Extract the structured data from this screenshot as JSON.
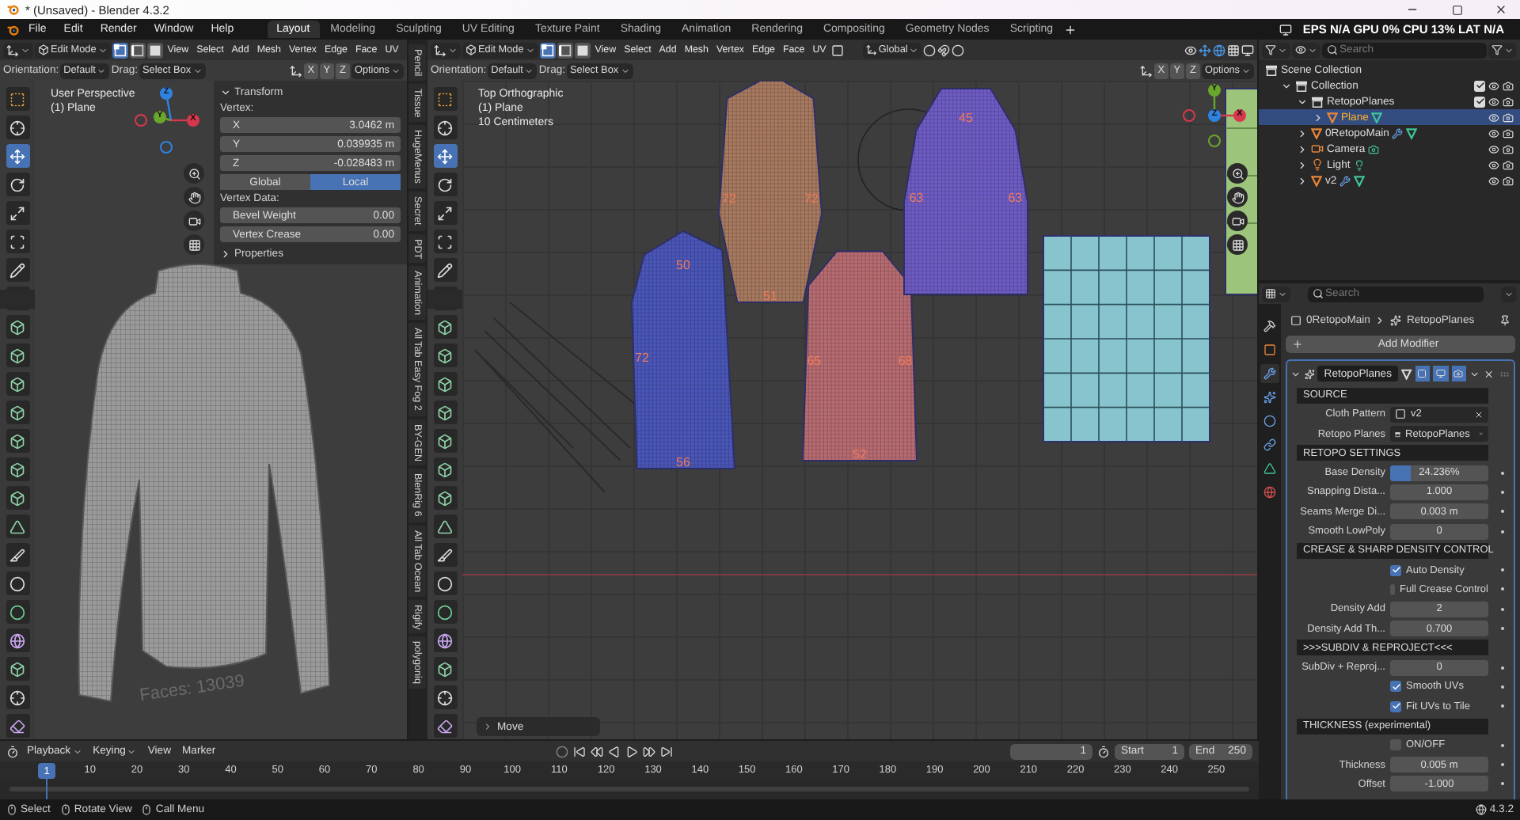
{
  "window": {
    "title": "* (Unsaved) - Blender 4.3.2"
  },
  "menu": [
    "File",
    "Edit",
    "Render",
    "Window",
    "Help"
  ],
  "workspaces": [
    {
      "label": "Layout",
      "selected": true
    },
    {
      "label": "Modeling",
      "selected": false
    },
    {
      "label": "Sculpting",
      "selected": false
    },
    {
      "label": "UV Editing",
      "selected": false
    },
    {
      "label": "Texture Paint",
      "selected": false
    },
    {
      "label": "Shading",
      "selected": false
    },
    {
      "label": "Animation",
      "selected": false
    },
    {
      "label": "Rendering",
      "selected": false
    },
    {
      "label": "Compositing",
      "selected": false
    },
    {
      "label": "Geometry Nodes",
      "selected": false
    },
    {
      "label": "Scripting",
      "selected": false
    }
  ],
  "stats": "EPS N/A GPU 0% CPU 13% LAT N/A",
  "left_viewport": {
    "mode": "Edit Mode",
    "select_modes": [
      {
        "kind": "vertex",
        "selected": true
      },
      {
        "kind": "edge",
        "selected": false
      },
      {
        "kind": "face",
        "selected": false
      }
    ],
    "menus": [
      "View",
      "Select",
      "Add",
      "Mesh",
      "Vertex",
      "Edge",
      "Face",
      "UV"
    ],
    "orientation_label": "Orientation:",
    "orientation": "Default",
    "drag_label": "Drag:",
    "drag": "Select Box",
    "axes": [
      "X",
      "Y",
      "Z"
    ],
    "options": "Options",
    "overlay": [
      "User Perspective",
      "(1) Plane"
    ],
    "gizmo": [
      "Z",
      "Y",
      "X"
    ],
    "faces": "Faces: 13039",
    "tools": [
      {
        "kind": "select",
        "selected": false
      },
      {
        "kind": "cursor",
        "selected": false
      },
      {
        "kind": "move",
        "selected": true
      },
      {
        "kind": "rotate",
        "selected": false
      },
      {
        "kind": "scale",
        "selected": false
      },
      {
        "kind": "transform",
        "selected": false
      },
      {
        "kind": "annotate",
        "selected": false
      },
      {
        "kind": "measure",
        "selected": false
      },
      {
        "kind": "cube",
        "selected": false
      },
      {
        "kind": "cube",
        "selected": false
      },
      {
        "kind": "cube",
        "selected": false
      },
      {
        "kind": "cube",
        "selected": false
      },
      {
        "kind": "cube",
        "selected": false
      },
      {
        "kind": "cube",
        "selected": false
      },
      {
        "kind": "cube",
        "selected": false
      },
      {
        "kind": "poly",
        "selected": false
      },
      {
        "kind": "knife",
        "selected": false
      },
      {
        "kind": "spin",
        "selected": false
      },
      {
        "kind": "smooth",
        "selected": false
      },
      {
        "kind": "sphere",
        "selected": false
      },
      {
        "kind": "cube",
        "selected": false
      },
      {
        "kind": "shrink",
        "selected": false
      },
      {
        "kind": "shear",
        "selected": false
      }
    ]
  },
  "sidebar": {
    "panel": "Transform",
    "group_label": "Vertex:",
    "coords": [
      {
        "axis": "X",
        "value": "3.0462 m"
      },
      {
        "axis": "Y",
        "value": "0.039935 m"
      },
      {
        "axis": "Z",
        "value": "-0.028483 m"
      }
    ],
    "space": [
      {
        "label": "Global",
        "selected": false
      },
      {
        "label": "Local",
        "selected": true
      }
    ],
    "data_label": "Vertex Data:",
    "data": [
      {
        "label": "Bevel Weight",
        "value": "0.00"
      },
      {
        "label": "Vertex Crease",
        "value": "0.00"
      }
    ],
    "subpanel": "Properties"
  },
  "sidebar_tabs": [
    "Pencil",
    "Tissue",
    "HugeMenus",
    "Secret",
    "PDT",
    "Animation",
    "All Tab Easy Fog 2",
    "BY-GEN",
    "BlenRig 6",
    "All Tab Ocean",
    "Rigify",
    "polygoniq"
  ],
  "main_viewport": {
    "mode": "Edit Mode",
    "select_modes": [
      {
        "kind": "vertex",
        "selected": true
      },
      {
        "kind": "edge",
        "selected": false
      },
      {
        "kind": "face",
        "selected": false
      }
    ],
    "menus": [
      "View",
      "Select",
      "Add",
      "Mesh",
      "Vertex",
      "Edge",
      "Face",
      "UV"
    ],
    "transform_orientation": "Global",
    "orientation_label": "Orientation:",
    "orientation": "Default",
    "drag_label": "Drag:",
    "drag": "Select Box",
    "axes": [
      "X",
      "Y",
      "Z"
    ],
    "options": "Options",
    "overlay": [
      "Top Orthographic",
      "(1) Plane",
      "10 Centimeters"
    ],
    "gizmo": [
      "Y",
      "Z",
      "X"
    ],
    "last_operation": "Move",
    "pieces": [
      {
        "kind": "sleeve",
        "color": "#4a56b8",
        "labels": [
          "50",
          "72",
          "56"
        ]
      },
      {
        "kind": "back",
        "color": "#a87a5e",
        "labels": [
          "72",
          "72",
          "51"
        ]
      },
      {
        "kind": "front",
        "color": "#b86c70",
        "labels": [
          "65",
          "68",
          "52"
        ]
      },
      {
        "kind": "upper",
        "color": "#6e5cc4",
        "labels": [
          "45",
          "63",
          "63"
        ]
      },
      {
        "kind": "grid",
        "color": "#88c4ce"
      },
      {
        "kind": "plane",
        "color": "#9cc47a"
      }
    ],
    "tools": [
      {
        "kind": "select",
        "selected": false
      },
      {
        "kind": "cursor",
        "selected": false
      },
      {
        "kind": "move",
        "selected": true
      },
      {
        "kind": "rotate",
        "selected": false
      },
      {
        "kind": "scale",
        "selected": false
      },
      {
        "kind": "transform",
        "selected": false
      },
      {
        "kind": "annotate",
        "selected": false
      },
      {
        "kind": "measure",
        "selected": false
      },
      {
        "kind": "cube",
        "selected": false
      },
      {
        "kind": "cube",
        "selected": false
      },
      {
        "kind": "cube",
        "selected": false
      },
      {
        "kind": "cube",
        "selected": false
      },
      {
        "kind": "cube",
        "selected": false
      },
      {
        "kind": "cube",
        "selected": false
      },
      {
        "kind": "cube",
        "selected": false
      },
      {
        "kind": "poly",
        "selected": false
      },
      {
        "kind": "knife",
        "selected": false
      },
      {
        "kind": "spin",
        "selected": false
      },
      {
        "kind": "smooth",
        "selected": false
      },
      {
        "kind": "sphere",
        "selected": false
      },
      {
        "kind": "cube",
        "selected": false
      },
      {
        "kind": "shrink",
        "selected": false
      },
      {
        "kind": "shear",
        "selected": false
      }
    ]
  },
  "outliner": {
    "search_placeholder": "Search",
    "tree": [
      {
        "label": "Scene Collection",
        "kind": "scene",
        "selected": false,
        "children": [
          {
            "label": "Collection",
            "kind": "collection",
            "expanded": true,
            "checked": true,
            "selected": false,
            "children": [
              {
                "label": "RetopoPlanes",
                "kind": "collection",
                "expanded": true,
                "checked": true,
                "selected": false,
                "children": [
                  {
                    "label": "Plane",
                    "kind": "mesh",
                    "expanded": false,
                    "selected": true,
                    "modifiers": false
                  }
                ]
              },
              {
                "label": "0RetopoMain",
                "kind": "mesh",
                "expanded": false,
                "selected": false,
                "modifiers": true
              },
              {
                "label": "Camera",
                "kind": "camera",
                "expanded": false,
                "selected": false
              },
              {
                "label": "Light",
                "kind": "light",
                "expanded": false,
                "selected": false
              },
              {
                "label": "v2",
                "kind": "mesh",
                "expanded": false,
                "selected": false,
                "modifiers": true
              }
            ]
          }
        ]
      }
    ]
  },
  "properties": {
    "search_placeholder": "Search",
    "tabs": [
      {
        "kind": "tool",
        "selected": false
      },
      {
        "kind": "object",
        "selected": false
      },
      {
        "kind": "modifier",
        "selected": true
      },
      {
        "kind": "particles",
        "selected": false
      },
      {
        "kind": "physics",
        "selected": false
      },
      {
        "kind": "constraints",
        "selected": false
      },
      {
        "kind": "data",
        "selected": false
      },
      {
        "kind": "material",
        "selected": false
      }
    ],
    "breadcrumb": [
      "0RetopoMain",
      "RetopoPlanes"
    ],
    "add_modifier": "Add Modifier",
    "modifier": {
      "name": "RetopoPlanes",
      "expanded": true,
      "rows": [
        {
          "kind": "section",
          "label": "SOURCE"
        },
        {
          "kind": "object",
          "label": "Cloth Pattern",
          "value": "v2"
        },
        {
          "kind": "collection",
          "label": "Retopo Planes",
          "value": "RetopoPlanes"
        },
        {
          "kind": "section",
          "label": "RETOPO SETTINGS"
        },
        {
          "kind": "slider",
          "label": "Base Density",
          "value": "24.236%",
          "level": 0.21
        },
        {
          "kind": "number",
          "label": "Snapping Dista...",
          "value": "1.000"
        },
        {
          "kind": "number",
          "label": "Seams Merge Di...",
          "value": "0.003 m"
        },
        {
          "kind": "number",
          "label": "Smooth LowPoly",
          "value": "0"
        },
        {
          "kind": "section",
          "label": "CREASE & SHARP DENSITY CONTROL"
        },
        {
          "kind": "check",
          "label": "Auto Density",
          "checked": true
        },
        {
          "kind": "check",
          "label": "Full Crease Control",
          "checked": false
        },
        {
          "kind": "number",
          "label": "Density Add",
          "value": "2"
        },
        {
          "kind": "number",
          "label": "Density Add Th...",
          "value": "0.700"
        },
        {
          "kind": "section",
          "label": ">>>SUBDIV & REPROJECT<<<"
        },
        {
          "kind": "number",
          "label": "SubDiv + Reproj...",
          "value": "0"
        },
        {
          "kind": "check",
          "label": "Smooth UVs",
          "checked": true
        },
        {
          "kind": "check",
          "label": "Fit UVs to Tile",
          "checked": true
        },
        {
          "kind": "section",
          "label": "THICKNESS (experimental)"
        },
        {
          "kind": "check",
          "label": "ON/OFF",
          "checked": false
        },
        {
          "kind": "number",
          "label": "Thickness",
          "value": "0.005 m"
        },
        {
          "kind": "number",
          "label": "Offset",
          "value": "-1.000"
        }
      ]
    }
  },
  "timeline": {
    "menus": [
      {
        "label": "Playback",
        "dropdown": true
      },
      {
        "label": "Keying",
        "dropdown": true
      },
      {
        "label": "View",
        "dropdown": false
      },
      {
        "label": "Marker",
        "dropdown": false
      }
    ],
    "current_frame": "1",
    "start_label": "Start",
    "start": "1",
    "end_label": "End",
    "end": "250",
    "playhead": "1",
    "ticks": [
      "10",
      "20",
      "30",
      "40",
      "50",
      "60",
      "70",
      "80",
      "90",
      "100",
      "110",
      "120",
      "130",
      "140",
      "150",
      "160",
      "170",
      "180",
      "190",
      "200",
      "210",
      "220",
      "230",
      "240",
      "250"
    ]
  },
  "status_bar": {
    "items": [
      "Select",
      "Rotate View",
      "Call Menu"
    ],
    "version": "4.3.2"
  }
}
